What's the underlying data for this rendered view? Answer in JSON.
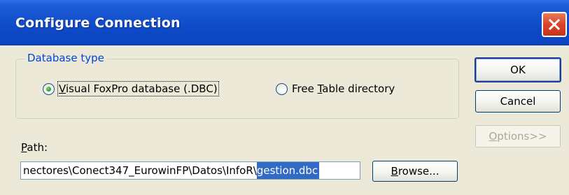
{
  "window": {
    "title": "Configure Connection"
  },
  "database_type": {
    "legend": "Database type",
    "options": [
      {
        "label_prefix": "",
        "mnemonic": "V",
        "label_rest": "isual FoxPro database (.DBC)",
        "selected": true
      },
      {
        "label_prefix": "Free ",
        "mnemonic": "T",
        "label_rest": "able directory",
        "selected": false
      }
    ]
  },
  "path": {
    "label_mnemonic": "P",
    "label_rest": "ath:",
    "value_prefix": "nectores\\Conect347_EurowinFP\\Datos\\InfoR\\",
    "value_selected": "gestion.dbc"
  },
  "buttons": {
    "ok": "OK",
    "cancel": "Cancel",
    "options_mnemonic": "O",
    "options_rest": "ptions>>",
    "browse_mnemonic": "B",
    "browse_rest": "rowse..."
  }
}
